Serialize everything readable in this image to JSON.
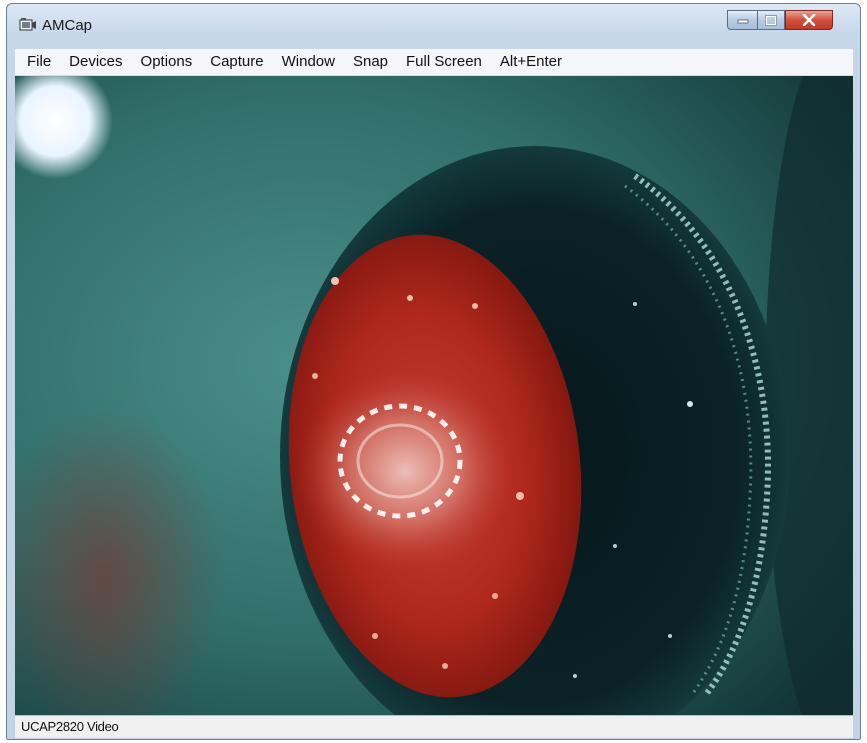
{
  "window": {
    "title": "AMCap",
    "icon": "camera-app-icon",
    "controls": [
      "minimize-icon",
      "maximize-icon",
      "close-icon"
    ]
  },
  "menu": {
    "items": [
      "File",
      "Devices",
      "Options",
      "Capture",
      "Window",
      "Snap",
      "Full Screen",
      "Alt+Enter"
    ]
  },
  "video": {
    "content": "live camera preview"
  },
  "status": {
    "text": "UCAP2820 Video"
  },
  "colors": {
    "title_bar": "#c7d7ea",
    "close_button": "#d2503c",
    "menu_bar": "#f4f6f9",
    "status_bar": "#f0f0f0"
  }
}
